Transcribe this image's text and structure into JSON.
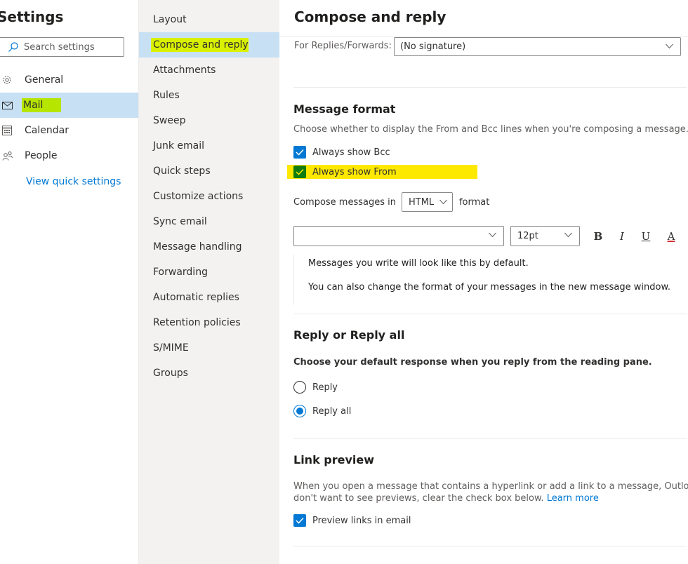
{
  "left_panel": {
    "title": "Settings",
    "search_placeholder": "Search settings",
    "items": [
      {
        "label": "General",
        "icon": "gear-icon"
      },
      {
        "label": "Mail",
        "icon": "mail-icon"
      },
      {
        "label": "Calendar",
        "icon": "calendar-icon"
      },
      {
        "label": "People",
        "icon": "people-icon"
      }
    ],
    "quick_settings_link": "View quick settings"
  },
  "mail_nav": {
    "items": [
      "Layout",
      "Compose and reply",
      "Attachments",
      "Rules",
      "Sweep",
      "Junk email",
      "Quick steps",
      "Customize actions",
      "Sync email",
      "Message handling",
      "Forwarding",
      "Automatic replies",
      "Retention policies",
      "S/MIME",
      "Groups"
    ],
    "selected": "Compose and reply"
  },
  "main": {
    "title": "Compose and reply",
    "signature": {
      "label": "For Replies/Forwards:",
      "value": "(No signature)"
    },
    "message_format": {
      "title": "Message format",
      "description": "Choose whether to display the From and Bcc lines when you're composing a message.",
      "always_show_bcc": {
        "label": "Always show Bcc",
        "checked": true
      },
      "always_show_from": {
        "label": "Always show From",
        "checked": true
      },
      "compose_prefix": "Compose messages in",
      "compose_format": "HTML",
      "compose_suffix": "format",
      "font_size": "12pt",
      "toolbar": {
        "bold": "B",
        "italic": "I",
        "underline": "U",
        "font_color": "A"
      },
      "preview_line1": "Messages you write will look like this by default.",
      "preview_line2": "You can also change the format of your messages in the new message window."
    },
    "reply": {
      "title": "Reply or Reply all",
      "description": "Choose your default response when you reply from the reading pane.",
      "options": [
        {
          "label": "Reply",
          "selected": false
        },
        {
          "label": "Reply all",
          "selected": true
        }
      ]
    },
    "link_preview": {
      "title": "Link preview",
      "description_line1": "When you open a message that contains a hyperlink or add a link to a message, Outlook in",
      "description_line2": "don't want to see previews, clear the check box below.",
      "learn_more": "Learn more",
      "checkbox": {
        "label": "Preview links in email",
        "checked": true
      }
    }
  },
  "colors": {
    "accent": "#0078d4",
    "selected_bg": "#c7e0f4",
    "highlight_green": "#b6e500",
    "highlight_yellow": "#fde800",
    "underline_red": "#d13438"
  }
}
